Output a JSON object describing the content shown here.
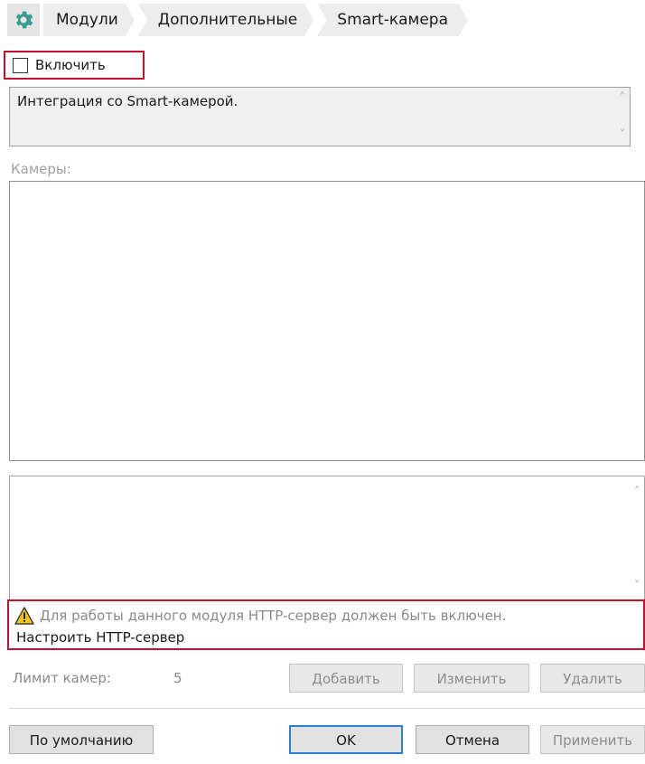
{
  "breadcrumb": {
    "icon": "gear-icon",
    "items": [
      "Модули",
      "Дополнительные",
      "Smart-камера"
    ]
  },
  "enable": {
    "label": "Включить",
    "checked": false
  },
  "description": "Интеграция со Smart-камерой.",
  "cameras": {
    "label": "Камеры:",
    "items": []
  },
  "warning": {
    "text": "Для работы данного модуля HTTP-сервер должен быть включен.",
    "link": "Настроить HTTP-сервер"
  },
  "limit": {
    "label": "Лимит камер:",
    "value": "5"
  },
  "actions": {
    "add": "Добавить",
    "edit": "Изменить",
    "delete": "Удалить"
  },
  "footer": {
    "defaults": "По умолчанию",
    "ok": "OK",
    "cancel": "Отмена",
    "apply": "Применить"
  },
  "colors": {
    "highlight": "#c8102e",
    "gear": "#3a9c8f",
    "focus": "#2a7fd4"
  }
}
